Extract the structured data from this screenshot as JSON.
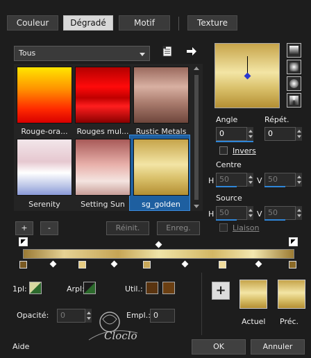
{
  "tabs": [
    "Couleur",
    "Dégradé",
    "Motif",
    "Texture"
  ],
  "category": "Tous",
  "gradients": [
    {
      "label": "Rouge-ora..."
    },
    {
      "label": "Rouges mul..."
    },
    {
      "label": "Rustic Metals"
    },
    {
      "label": "Serenity"
    },
    {
      "label": "Setting Sun"
    },
    {
      "label": "sg_golden"
    }
  ],
  "list_buttons": {
    "add": "+",
    "remove": "-",
    "reset": "Réinit.",
    "save": "Enreg."
  },
  "angle": {
    "label": "Angle",
    "value": "0"
  },
  "repeat": {
    "label": "Répét.",
    "value": "0"
  },
  "invert": {
    "label": "Invers",
    "checked": false
  },
  "center": {
    "label": "Centre",
    "h_label": "H",
    "h": "50",
    "v_label": "V",
    "v": "50"
  },
  "source": {
    "label": "Source",
    "h_label": "H",
    "h": "50",
    "v_label": "V",
    "v": "50"
  },
  "link": {
    "label": "Liaison",
    "checked": false
  },
  "stops": {
    "first_plan_label": "1pl:",
    "background_label": "Arpl:",
    "user_label": "Util.:",
    "opacity_label": "Opacité:",
    "opacity_value": "0",
    "location_label": "Empl.:",
    "location_value": "0",
    "user_colors": [
      "#5a3410",
      "#6b3f12"
    ]
  },
  "preview": {
    "current_label": "Actuel",
    "previous_label": "Préc.",
    "add_symbol": "+"
  },
  "footer": {
    "help": "Aide",
    "ok": "OK",
    "cancel": "Annuler"
  },
  "watermark": "Cloclo",
  "colors": {
    "accent": "#2f86d8",
    "gold_light": "#f2e2a0",
    "gold_dark": "#b8952e"
  }
}
